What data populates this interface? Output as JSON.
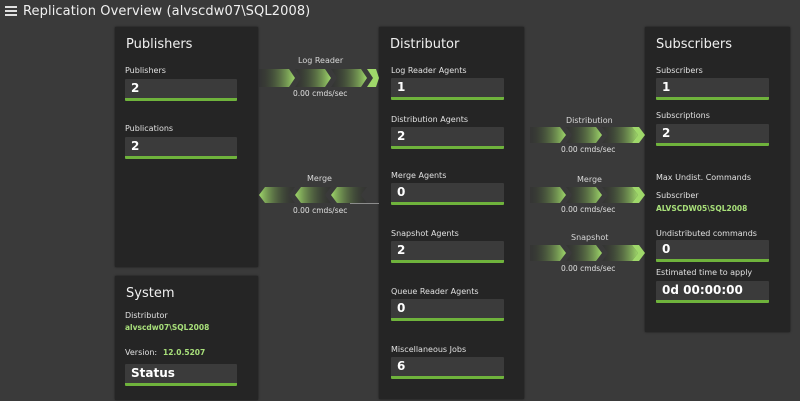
{
  "window": {
    "title": "Replication Overview (alvscdw07\\SQL2008)"
  },
  "publishers": {
    "title": "Publishers",
    "publishers_label": "Publishers",
    "publishers_value": "2",
    "publications_label": "Publications",
    "publications_value": "2"
  },
  "system": {
    "title": "System",
    "distributor_label": "Distributor",
    "distributor_value": "alvscdw07\\SQL2008",
    "version_label": "Version:",
    "version_value": "12.0.5207",
    "status_label": "Status"
  },
  "distributor": {
    "title": "Distributor",
    "log_reader_agents_label": "Log Reader Agents",
    "log_reader_agents_value": "1",
    "distribution_agents_label": "Distribution Agents",
    "distribution_agents_value": "2",
    "merge_agents_label": "Merge Agents",
    "merge_agents_value": "0",
    "snapshot_agents_label": "Snapshot Agents",
    "snapshot_agents_value": "2",
    "queue_reader_agents_label": "Queue Reader Agents",
    "queue_reader_agents_value": "0",
    "misc_jobs_label": "Miscellaneous Jobs",
    "misc_jobs_value": "6"
  },
  "subscribers": {
    "title": "Subscribers",
    "subscribers_label": "Subscribers",
    "subscribers_value": "1",
    "subscriptions_label": "Subscriptions",
    "subscriptions_value": "2",
    "max_undist_label": "Max Undist. Commands",
    "subscriber_label": "Subscriber",
    "subscriber_value": "ALVSCDW05\\SQL2008",
    "undistributed_label": "Undistributed commands",
    "undistributed_value": "0",
    "eta_label": "Estimated time to apply",
    "eta_value": "0d 00:00:00"
  },
  "flows": {
    "log_reader": {
      "label": "Log Reader",
      "rate": "0.00 cmds/sec"
    },
    "merge_left": {
      "label": "Merge",
      "rate": "0.00 cmds/sec"
    },
    "distribution": {
      "label": "Distribution",
      "rate": "0.00 cmds/sec"
    },
    "merge_right": {
      "label": "Merge",
      "rate": "0.00 cmds/sec"
    },
    "snapshot": {
      "label": "Snapshot",
      "rate": "0.00 cmds/sec"
    }
  },
  "colors": {
    "accent_green": "#6fb33c",
    "highlight_green": "#a8e07a",
    "panel_bg": "#252525",
    "page_bg": "#3a3a3a"
  },
  "icons": {
    "menu": "hamburger-menu-icon"
  }
}
